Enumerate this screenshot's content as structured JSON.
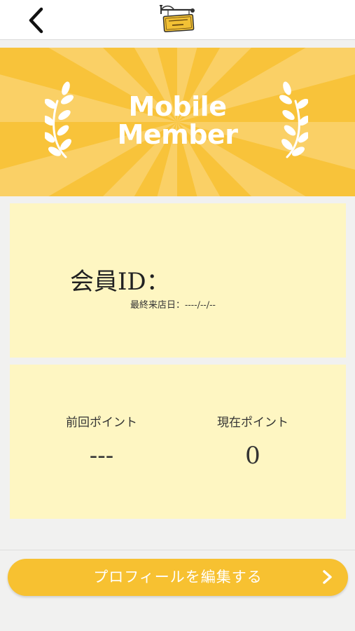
{
  "header": {
    "back_icon": "chevron-left-icon",
    "logo_icon": "shop-sign-logo-icon"
  },
  "hero": {
    "title_line1": "Mobile",
    "title_line2": "Member",
    "background_color": "#f8c33a",
    "left_icon": "laurel-left-icon",
    "right_icon": "laurel-right-icon"
  },
  "member_card": {
    "id_label": "会員ID：",
    "last_visit_label": "最終来店日：",
    "last_visit_value": "----/--/--",
    "background_color": "#fef6c2"
  },
  "points": {
    "previous_label": "前回ポイント",
    "previous_value": "---",
    "current_label": "現在ポイント",
    "current_value": "0"
  },
  "actions": {
    "edit_profile_label": "プロフィールを編集する",
    "edit_profile_icon": "chevron-right-icon",
    "button_color": "#f7c131"
  }
}
